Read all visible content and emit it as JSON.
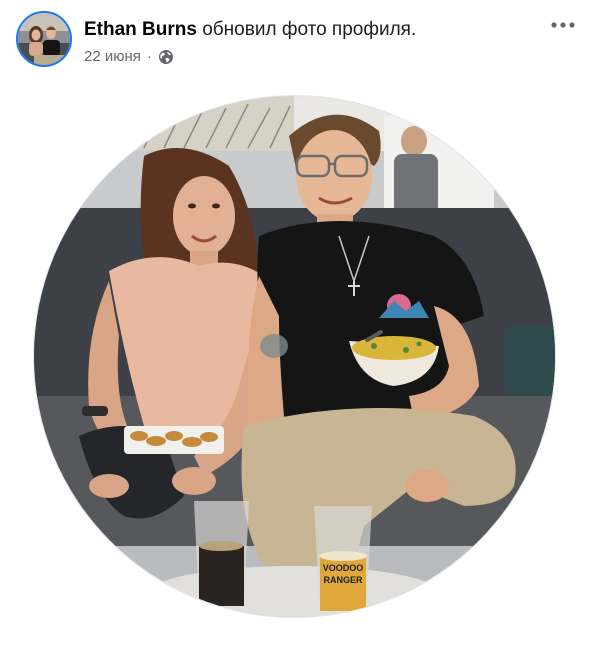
{
  "post": {
    "author_name": "Ethan Burns",
    "action_text": "обновил фото профиля.",
    "date": "22 июня",
    "separator": "·",
    "privacy_icon": "globe-icon",
    "more_icon": "more-horizontal-icon"
  },
  "photo": {
    "glass_label_line1": "VOODOO",
    "glass_label_line2": "RANGER"
  },
  "colors": {
    "avatar_ring": "#1877f2",
    "name_text": "#050505",
    "meta_text": "#65676b"
  }
}
